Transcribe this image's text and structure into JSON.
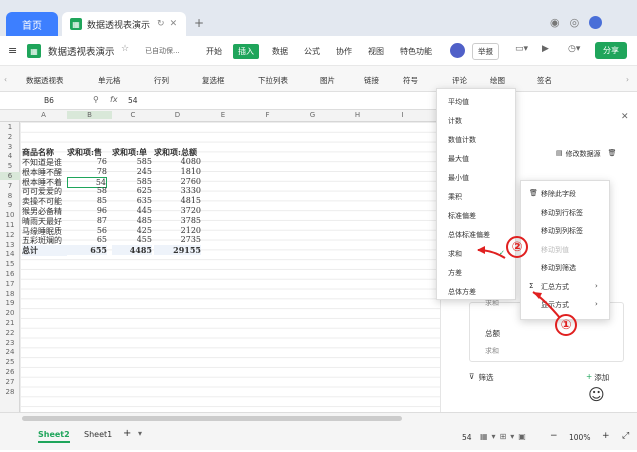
{
  "tabs": {
    "home": "首页",
    "doc": "数据透视表演示"
  },
  "menubar": {
    "title": "数据透视表演示",
    "autosave": "已自动保...",
    "items": [
      "开始",
      "插入",
      "数据",
      "公式",
      "协作",
      "视图",
      "特色功能"
    ],
    "active": "插入",
    "user_btn": "举报",
    "share": "分享"
  },
  "toolbar": {
    "items": [
      "数据透视表",
      "单元格",
      "行列",
      "复选框",
      "下拉列表",
      "图片",
      "链接",
      "符号",
      "评论",
      "绘图",
      "签名"
    ]
  },
  "formula": {
    "cellref": "B6",
    "fx": "fx",
    "value": "54"
  },
  "columns": [
    "A",
    "B",
    "C",
    "D",
    "E",
    "F",
    "G",
    "H",
    "I"
  ],
  "rows": [
    "1",
    "2",
    "3",
    "4",
    "5",
    "6",
    "7",
    "8",
    "9",
    "10",
    "11",
    "12",
    "13",
    "14",
    "15",
    "16",
    "17",
    "18",
    "19",
    "20",
    "21",
    "22",
    "23",
    "24",
    "25",
    "26",
    "27",
    "28"
  ],
  "pivot": {
    "headers": [
      "商品名称",
      "求和项:售",
      "求和项:单",
      "求和项:总额"
    ],
    "rows": [
      [
        "不知道是谁",
        "76",
        "585",
        "4080"
      ],
      [
        "根本睡不醒",
        "78",
        "245",
        "1810"
      ],
      [
        "根本睡不着",
        "54",
        "585",
        "2760"
      ],
      [
        "可可爱爱的",
        "58",
        "625",
        "3330"
      ],
      [
        "卖操不可能",
        "85",
        "635",
        "4815"
      ],
      [
        "猴男必备精",
        "96",
        "445",
        "3720"
      ],
      [
        "晴雨天最好",
        "87",
        "485",
        "3785"
      ],
      [
        "马缘睡眠质",
        "56",
        "425",
        "2120"
      ],
      [
        "五彩斑斓的",
        "65",
        "455",
        "2735"
      ]
    ],
    "total": [
      "总计",
      "655",
      "4485",
      "29155"
    ]
  },
  "panel": {
    "edit_source": "修改数据源",
    "filter": "筛选",
    "add": "添加",
    "field1_label": "求和",
    "field2_title": "总额",
    "field2_value": "求和"
  },
  "menu1": {
    "items": [
      "平均值",
      "计数",
      "数值计数",
      "最大值",
      "最小值",
      "乘积",
      "标准偏差",
      "总体标准偏差",
      "求和",
      "方差",
      "总体方差"
    ],
    "checked": "求和"
  },
  "menu2": {
    "items": [
      "移除此字段",
      "移动到行标签",
      "移动到列标签",
      "移动到值",
      "移动到筛选",
      "汇总方式",
      "显示方式"
    ]
  },
  "annotations": {
    "one": "①",
    "two": "②"
  },
  "bottom": {
    "sheets": [
      "Sheet2",
      "Sheet1"
    ],
    "active": "Sheet2",
    "add": "+",
    "status_value": "54",
    "zoom": "100%"
  }
}
